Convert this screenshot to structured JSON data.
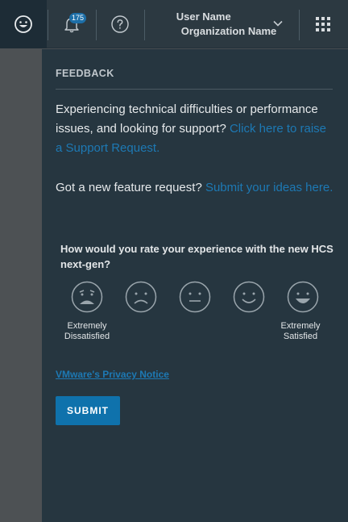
{
  "header": {
    "notification_count": "175",
    "user_name": "User Name",
    "organization_name": "Organization Name",
    "icons": [
      "smiley-feedback-icon",
      "bell-icon",
      "help-circle-icon",
      "chevron-down-icon",
      "app-grid-icon"
    ]
  },
  "panel": {
    "title": "FEEDBACK",
    "support_text": "Experiencing technical difficulties or performance issues, and looking for support?",
    "support_link": "Click here to raise a Support Request.",
    "feature_text": "Got a new feature request?",
    "feature_link": "Submit your ideas here.",
    "rating_question": "How would you rate your experience with the new HCS next-gen?",
    "rating_options": [
      "very-sad-face-icon",
      "sad-face-icon",
      "neutral-face-icon",
      "happy-face-icon",
      "very-happy-face-icon"
    ],
    "scale_low": "Extremely Dissatisfied",
    "scale_high": "Extremely Satisfied",
    "privacy_link": "VMware's Privacy Notice",
    "submit_label": "SUBMIT"
  },
  "colors": {
    "link": "#1d79b4",
    "button": "#0f72ac",
    "panel_bg": "#263640",
    "header_bg": "#2c3941"
  }
}
